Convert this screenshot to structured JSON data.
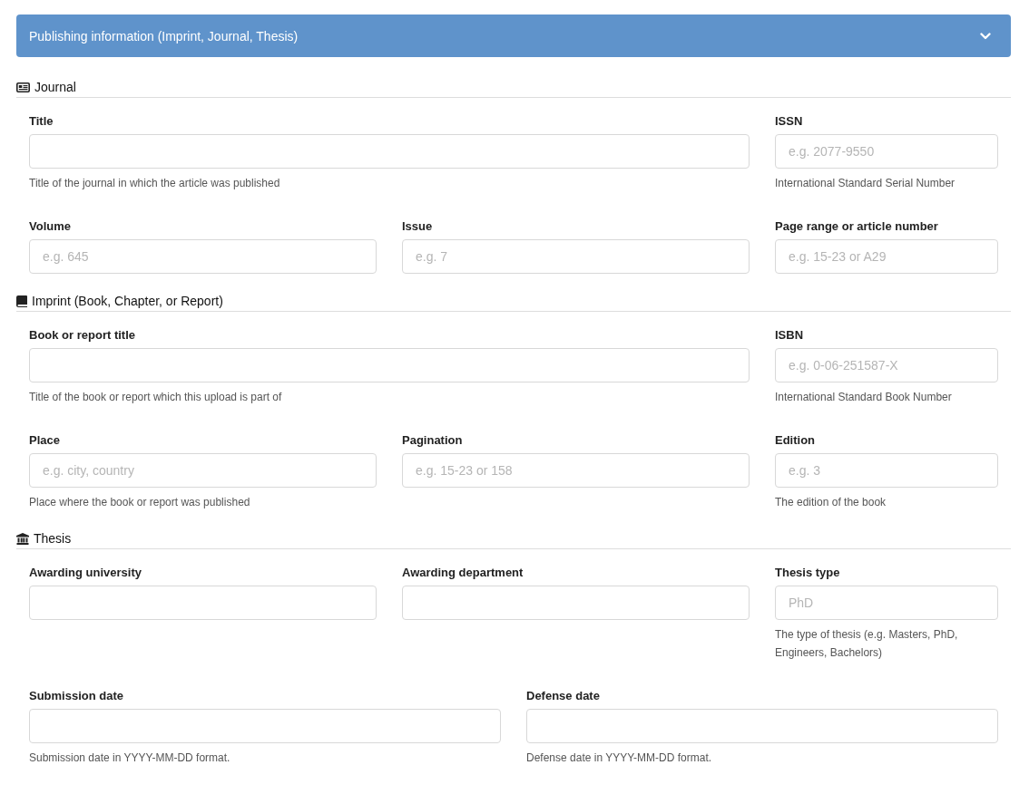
{
  "panel": {
    "title": "Publishing information (Imprint, Journal, Thesis)"
  },
  "sections": [
    {
      "kind": "journal",
      "title": "Journal",
      "rows": [
        {
          "kind": "wide-narrow",
          "fields": [
            {
              "label": "Title",
              "help": "Title of the journal in which the article was published"
            },
            {
              "label": "ISSN",
              "placeholder": "e.g. 2077-9550",
              "help": "International Standard Serial Number"
            }
          ]
        },
        {
          "kind": "thirds",
          "fields": [
            {
              "label": "Volume",
              "placeholder": "e.g. 645"
            },
            {
              "label": "Issue",
              "placeholder": "e.g. 7"
            },
            {
              "label": "Page range or article number",
              "placeholder": "e.g. 15-23 or A29"
            }
          ]
        }
      ]
    },
    {
      "kind": "book",
      "title": "Imprint (Book, Chapter, or Report)",
      "rows": [
        {
          "kind": "wide-narrow",
          "fields": [
            {
              "label": "Book or report title",
              "help": "Title of the book or report which this upload is part of"
            },
            {
              "label": "ISBN",
              "placeholder": "e.g. 0-06-251587-X",
              "help": "International Standard Book Number"
            }
          ]
        },
        {
          "kind": "thirds",
          "fields": [
            {
              "label": "Place",
              "placeholder": "e.g. city, country",
              "help": "Place where the book or report was published"
            },
            {
              "label": "Pagination",
              "placeholder": "e.g. 15-23 or 158"
            },
            {
              "label": "Edition",
              "placeholder": "e.g. 3",
              "help": "The edition of the book"
            }
          ]
        }
      ]
    },
    {
      "kind": "thesis",
      "title": "Thesis",
      "rows": [
        {
          "kind": "thirds",
          "fields": [
            {
              "label": "Awarding university"
            },
            {
              "label": "Awarding department"
            },
            {
              "label": "Thesis type",
              "placeholder": "PhD",
              "help": "The type of thesis (e.g. Masters, PhD, Engineers, Bachelors)"
            }
          ]
        },
        {
          "kind": "halves",
          "fields": [
            {
              "label": "Submission date",
              "help": "Submission date in YYYY-MM-DD format."
            },
            {
              "label": "Defense date",
              "help": "Defense date in YYYY-MM-DD format."
            }
          ]
        }
      ]
    }
  ]
}
